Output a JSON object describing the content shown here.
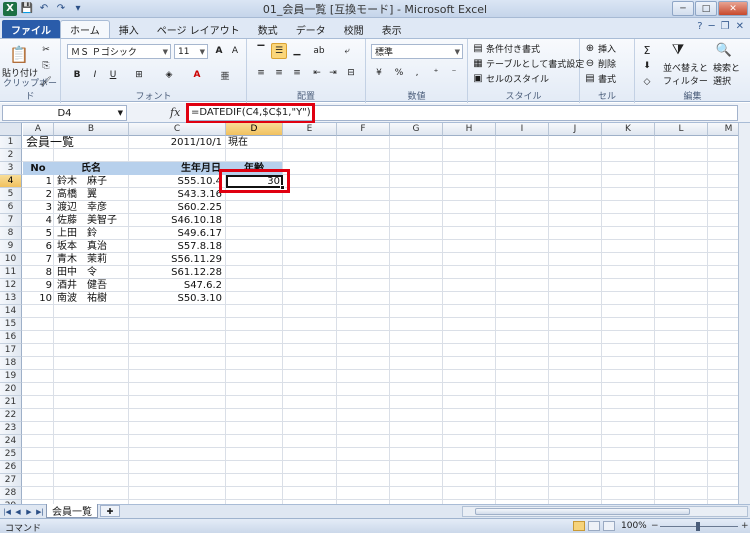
{
  "window": {
    "title": "01_会員一覧 [互換モード] - Microsoft Excel",
    "min": "─",
    "max": "□",
    "close": "✕"
  },
  "tabs": [
    "ファイル",
    "ホーム",
    "挿入",
    "ページ レイアウト",
    "数式",
    "データ",
    "校閲",
    "表示"
  ],
  "ribbon": {
    "clipboard": {
      "label": "クリップボード",
      "paste": "貼り付け"
    },
    "font": {
      "label": "フォント",
      "name": "ＭＳ Ｐゴシック",
      "size": "11"
    },
    "alignment": {
      "label": "配置"
    },
    "number": {
      "label": "数値",
      "format": "標準"
    },
    "styles": {
      "label": "スタイル",
      "conditional": "条件付き書式",
      "table": "テーブルとして書式設定",
      "cell": "セルのスタイル"
    },
    "cells": {
      "label": "セル",
      "insert": "挿入",
      "delete": "削除",
      "format": "書式"
    },
    "editing": {
      "label": "編集",
      "sort": "並べ替えと",
      "filter": "フィルター",
      "find": "検索と",
      "select": "選択"
    }
  },
  "formula_bar": {
    "name_box": "D4",
    "formula": "=DATEDIF(C4,$C$1,\"Y\")"
  },
  "columns": [
    "A",
    "B",
    "C",
    "D",
    "E",
    "F",
    "G",
    "H",
    "I",
    "J",
    "K",
    "L",
    "M"
  ],
  "rows": [
    "1",
    "2",
    "3",
    "4",
    "5",
    "6",
    "7",
    "8",
    "9",
    "10",
    "11",
    "12",
    "13",
    "14",
    "15",
    "16",
    "17",
    "18",
    "19",
    "20",
    "21",
    "22",
    "23",
    "24",
    "25",
    "26",
    "27",
    "28",
    "29"
  ],
  "sheet": {
    "title": "会員一覧",
    "date": "2011/10/1",
    "date_suffix": "現在",
    "headers": {
      "no": "No",
      "name": "氏名",
      "birth": "生年月日",
      "age": "年齢"
    },
    "members": [
      {
        "no": "1",
        "name": "鈴木　麻子",
        "birth": "S55.10.4",
        "age": "30"
      },
      {
        "no": "2",
        "name": "高橋　翼",
        "birth": "S43.3.16",
        "age": ""
      },
      {
        "no": "3",
        "name": "渡辺　幸彦",
        "birth": "S60.2.25",
        "age": ""
      },
      {
        "no": "4",
        "name": "佐藤　美智子",
        "birth": "S46.10.18",
        "age": ""
      },
      {
        "no": "5",
        "name": "上田　鈴",
        "birth": "S49.6.17",
        "age": ""
      },
      {
        "no": "6",
        "name": "坂本　真治",
        "birth": "S57.8.18",
        "age": ""
      },
      {
        "no": "7",
        "name": "青木　茉莉",
        "birth": "S56.11.29",
        "age": ""
      },
      {
        "no": "8",
        "name": "田中　令",
        "birth": "S61.12.28",
        "age": ""
      },
      {
        "no": "9",
        "name": "酒井　健吾",
        "birth": "S47.6.2",
        "age": ""
      },
      {
        "no": "10",
        "name": "南波　祐樹",
        "birth": "S50.3.10",
        "age": ""
      }
    ]
  },
  "sheet_tabs": [
    "会員一覧"
  ],
  "status": {
    "mode": "コマンド",
    "zoom": "100%"
  }
}
